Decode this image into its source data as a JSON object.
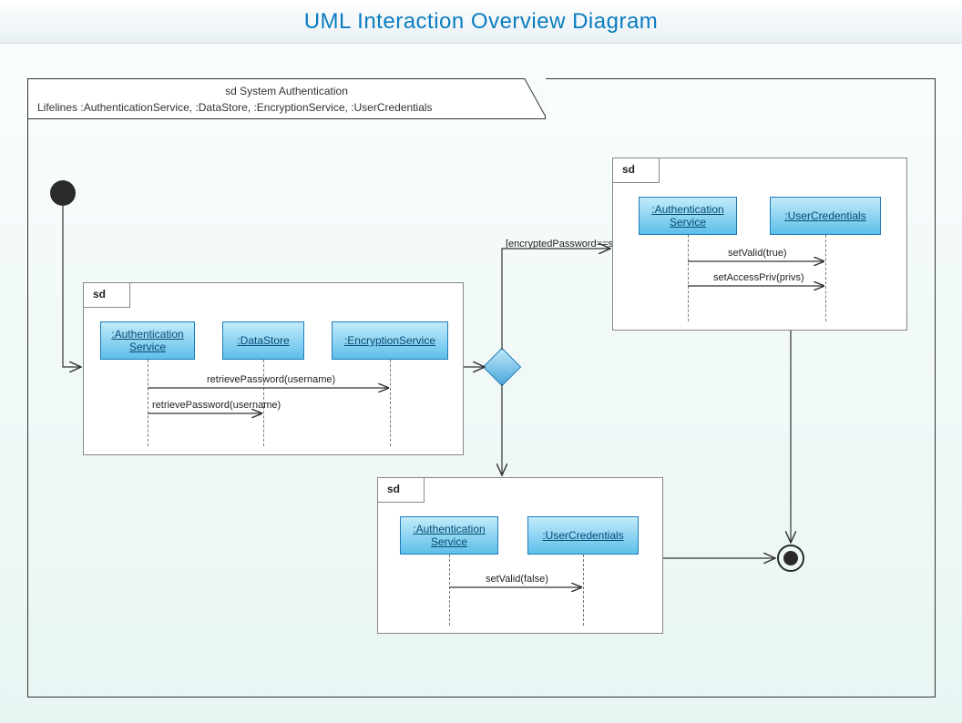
{
  "title": "UML Interaction Overview Diagram",
  "mainFrame": {
    "line1": "sd System Authentication",
    "line2": "Lifelines :AuthenticationService, :DataStore, :EncryptionService, :UserCredentials"
  },
  "sd1": {
    "tab": "sd",
    "ll1": ":Authentication Service",
    "ll2": ":DataStore",
    "ll3": ":EncryptionService",
    "msg1": "retrievePassword(username)",
    "msg2": "retrievePassword(username)"
  },
  "sd2": {
    "tab": "sd",
    "ll1": ":Authentication Service",
    "ll2": ":UserCredentials",
    "msg1": "setValid(true)",
    "msg2": "setAccessPriv(privs)"
  },
  "sd3": {
    "tab": "sd",
    "ll1": ":Authentication Service",
    "ll2": ":UserCredentials",
    "msg1": "setValid(false)"
  },
  "guard": "[encryptedPassword==storedPassword]"
}
